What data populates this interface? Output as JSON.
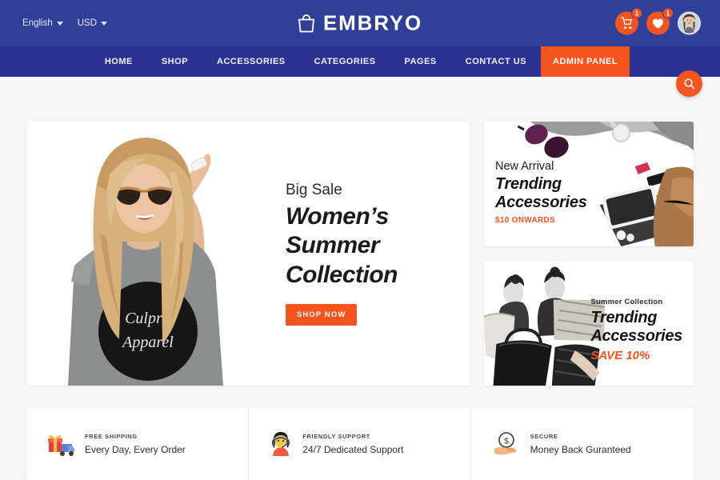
{
  "header": {
    "locales": [
      {
        "label": "English",
        "icon": "chevron-down-icon"
      },
      {
        "label": "USD",
        "icon": "chevron-down-icon"
      }
    ],
    "brand": {
      "name": "EMBRYO",
      "icon": "shopping-bag-icon"
    },
    "actions": {
      "cart": {
        "icon": "cart-icon",
        "badge": "1"
      },
      "wishlist": {
        "icon": "heart-icon",
        "badge": "1"
      },
      "avatar": {
        "icon": "user-avatar"
      }
    },
    "accent_color": "#f4551f",
    "header_bg": "#313f99",
    "nav_bg": "#2a3391"
  },
  "nav": {
    "items": [
      {
        "label": "HOME"
      },
      {
        "label": "SHOP"
      },
      {
        "label": "ACCESSORIES"
      },
      {
        "label": "CATEGORIES"
      },
      {
        "label": "PAGES"
      },
      {
        "label": "CONTACT US"
      },
      {
        "label": "ADMIN PANEL",
        "highlight": true
      }
    ],
    "search": {
      "icon": "search-icon"
    }
  },
  "hero": {
    "kicker": "Big Sale",
    "title_line1": "Women’s",
    "title_line2": "Summer",
    "title_line3": "Collection",
    "cta": "SHOP NOW",
    "image_alt": "woman-in-sunglasses-grey-tshirt",
    "shirt_text_1": "Culprit",
    "shirt_text_2": "Apparel"
  },
  "side_banners": [
    {
      "kicker": "New Arrival",
      "title_line1": "Trending",
      "title_line2": "Accessories",
      "price": "$10 ONWARDS",
      "image_alt": "accessories-flatlay-sunglasses-phone-lipstick-bag"
    },
    {
      "kicker": "Summer Collection",
      "title_line1": "Trending",
      "title_line2": "Accessories",
      "save": "SAVE 10%",
      "image_alt": "two-women-with-woven-handbags-bw"
    }
  ],
  "features": [
    {
      "kicker": "FREE SHIPPING",
      "title": "Every Day, Every Order",
      "icon": "gift-truck-icon"
    },
    {
      "kicker": "FRIENDLY SUPPORT",
      "title": "24/7 Dedicated Support",
      "icon": "support-agent-icon"
    },
    {
      "kicker": "SECURE",
      "title": "Money Back Guranteed",
      "icon": "hand-coin-icon"
    }
  ]
}
